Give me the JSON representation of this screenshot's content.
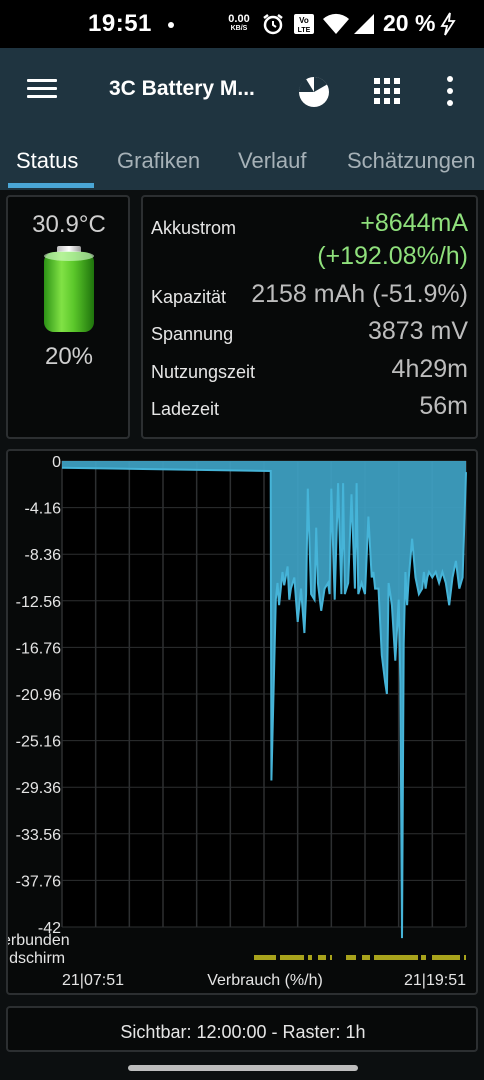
{
  "status_bar": {
    "time": "19:51",
    "net_speed_value": "0.00",
    "net_speed_unit": "KB/S",
    "battery_text": "20 %"
  },
  "app_bar": {
    "title": "3C Battery M..."
  },
  "tabs": [
    {
      "label": "Status",
      "active": true
    },
    {
      "label": "Grafiken",
      "active": false
    },
    {
      "label": "Verlauf",
      "active": false
    },
    {
      "label": "Schätzungen",
      "active": false
    }
  ],
  "battery_panel": {
    "temperature": "30.9°C",
    "level_text": "20%",
    "level_fraction": 0.2
  },
  "stats": {
    "current_label": "Akkustrom",
    "current_value": "+8644mA",
    "current_rate": "(+192.08%/h)",
    "capacity_label": "Kapazität",
    "capacity_value": "2158 mAh (-51.9%)",
    "voltage_label": "Spannung",
    "voltage_value": "3873 mV",
    "usage_label": "Nutzungszeit",
    "usage_value": "4h29m",
    "charge_label": "Ladezeit",
    "charge_value": "56m"
  },
  "chart_data": {
    "type": "area",
    "ylim": [
      -42,
      0
    ],
    "y_ticks": [
      "0",
      "-4.16",
      "-8.36",
      "-12.56",
      "-16.76",
      "-20.96",
      "-25.16",
      "-29.36",
      "-33.56",
      "-37.76",
      "-42"
    ],
    "x_start_label": "21|07:51",
    "x_end_label": "21|19:51",
    "x_axis_title": "Verbrauch (%/h)",
    "extra_labels": [
      "erbunden",
      "ildschirm"
    ],
    "colors": {
      "fill": "#3fa3c6",
      "line": "#46b4d8",
      "grid": "#2d2f31",
      "bar": "#a8a31c"
    },
    "x_hours": [
      0,
      6.2,
      6.22,
      6.35,
      6.4,
      6.45,
      6.55,
      6.6,
      6.7,
      6.75,
      6.8,
      6.9,
      7.0,
      7.1,
      7.2,
      7.25,
      7.3,
      7.4,
      7.5,
      7.55,
      7.6,
      7.7,
      7.8,
      7.9,
      7.95,
      8.0,
      8.1,
      8.2,
      8.3,
      8.35,
      8.4,
      8.5,
      8.6,
      8.7,
      8.75,
      8.8,
      8.9,
      9.0,
      9.1,
      9.2,
      9.25,
      9.3,
      9.4,
      9.5,
      9.6,
      9.65,
      9.7,
      9.75,
      9.8,
      9.9,
      10.0,
      10.05,
      10.1,
      10.15,
      10.2,
      10.25,
      10.3,
      10.4,
      10.5,
      10.6,
      10.7,
      10.75,
      10.8,
      10.85,
      10.9,
      11.0,
      11.1,
      11.2,
      11.3,
      11.4,
      11.5,
      11.6,
      11.7,
      11.8,
      11.9,
      12.0
    ],
    "y_values": [
      -0.6,
      -0.9,
      -28.8,
      -12.5,
      -11.0,
      -13.0,
      -10.0,
      -11.2,
      -9.5,
      -12.5,
      -11.5,
      -10.5,
      -14.5,
      -11.5,
      -15.5,
      -12.0,
      -2.5,
      -12.0,
      -12.5,
      -6.0,
      -11.0,
      -13.5,
      -11.5,
      -11.0,
      -12.0,
      -2.5,
      -12.5,
      -2.0,
      -12.0,
      -2.0,
      -12.0,
      -11.0,
      -3.0,
      -11.5,
      -2.0,
      -12.0,
      -11.0,
      -12.0,
      -5.0,
      -10.5,
      -10.0,
      -11.5,
      -11.5,
      -17.5,
      -20.0,
      -21.0,
      -11.0,
      -12.0,
      -13.0,
      -18.0,
      -12.5,
      -20.0,
      -43.0,
      -16.5,
      -10.0,
      -13.0,
      -10.5,
      -7.0,
      -10.5,
      -12.0,
      -11.5,
      -10.0,
      -11.5,
      -10.5,
      -10.0,
      -10.5,
      -10.0,
      -11.0,
      -10.0,
      -11.0,
      -13.0,
      -10.5,
      -9.0,
      -11.5,
      -10.5,
      -1.0
    ]
  },
  "footer": {
    "text": "Sichtbar: 12:00:00 - Raster: 1h"
  }
}
